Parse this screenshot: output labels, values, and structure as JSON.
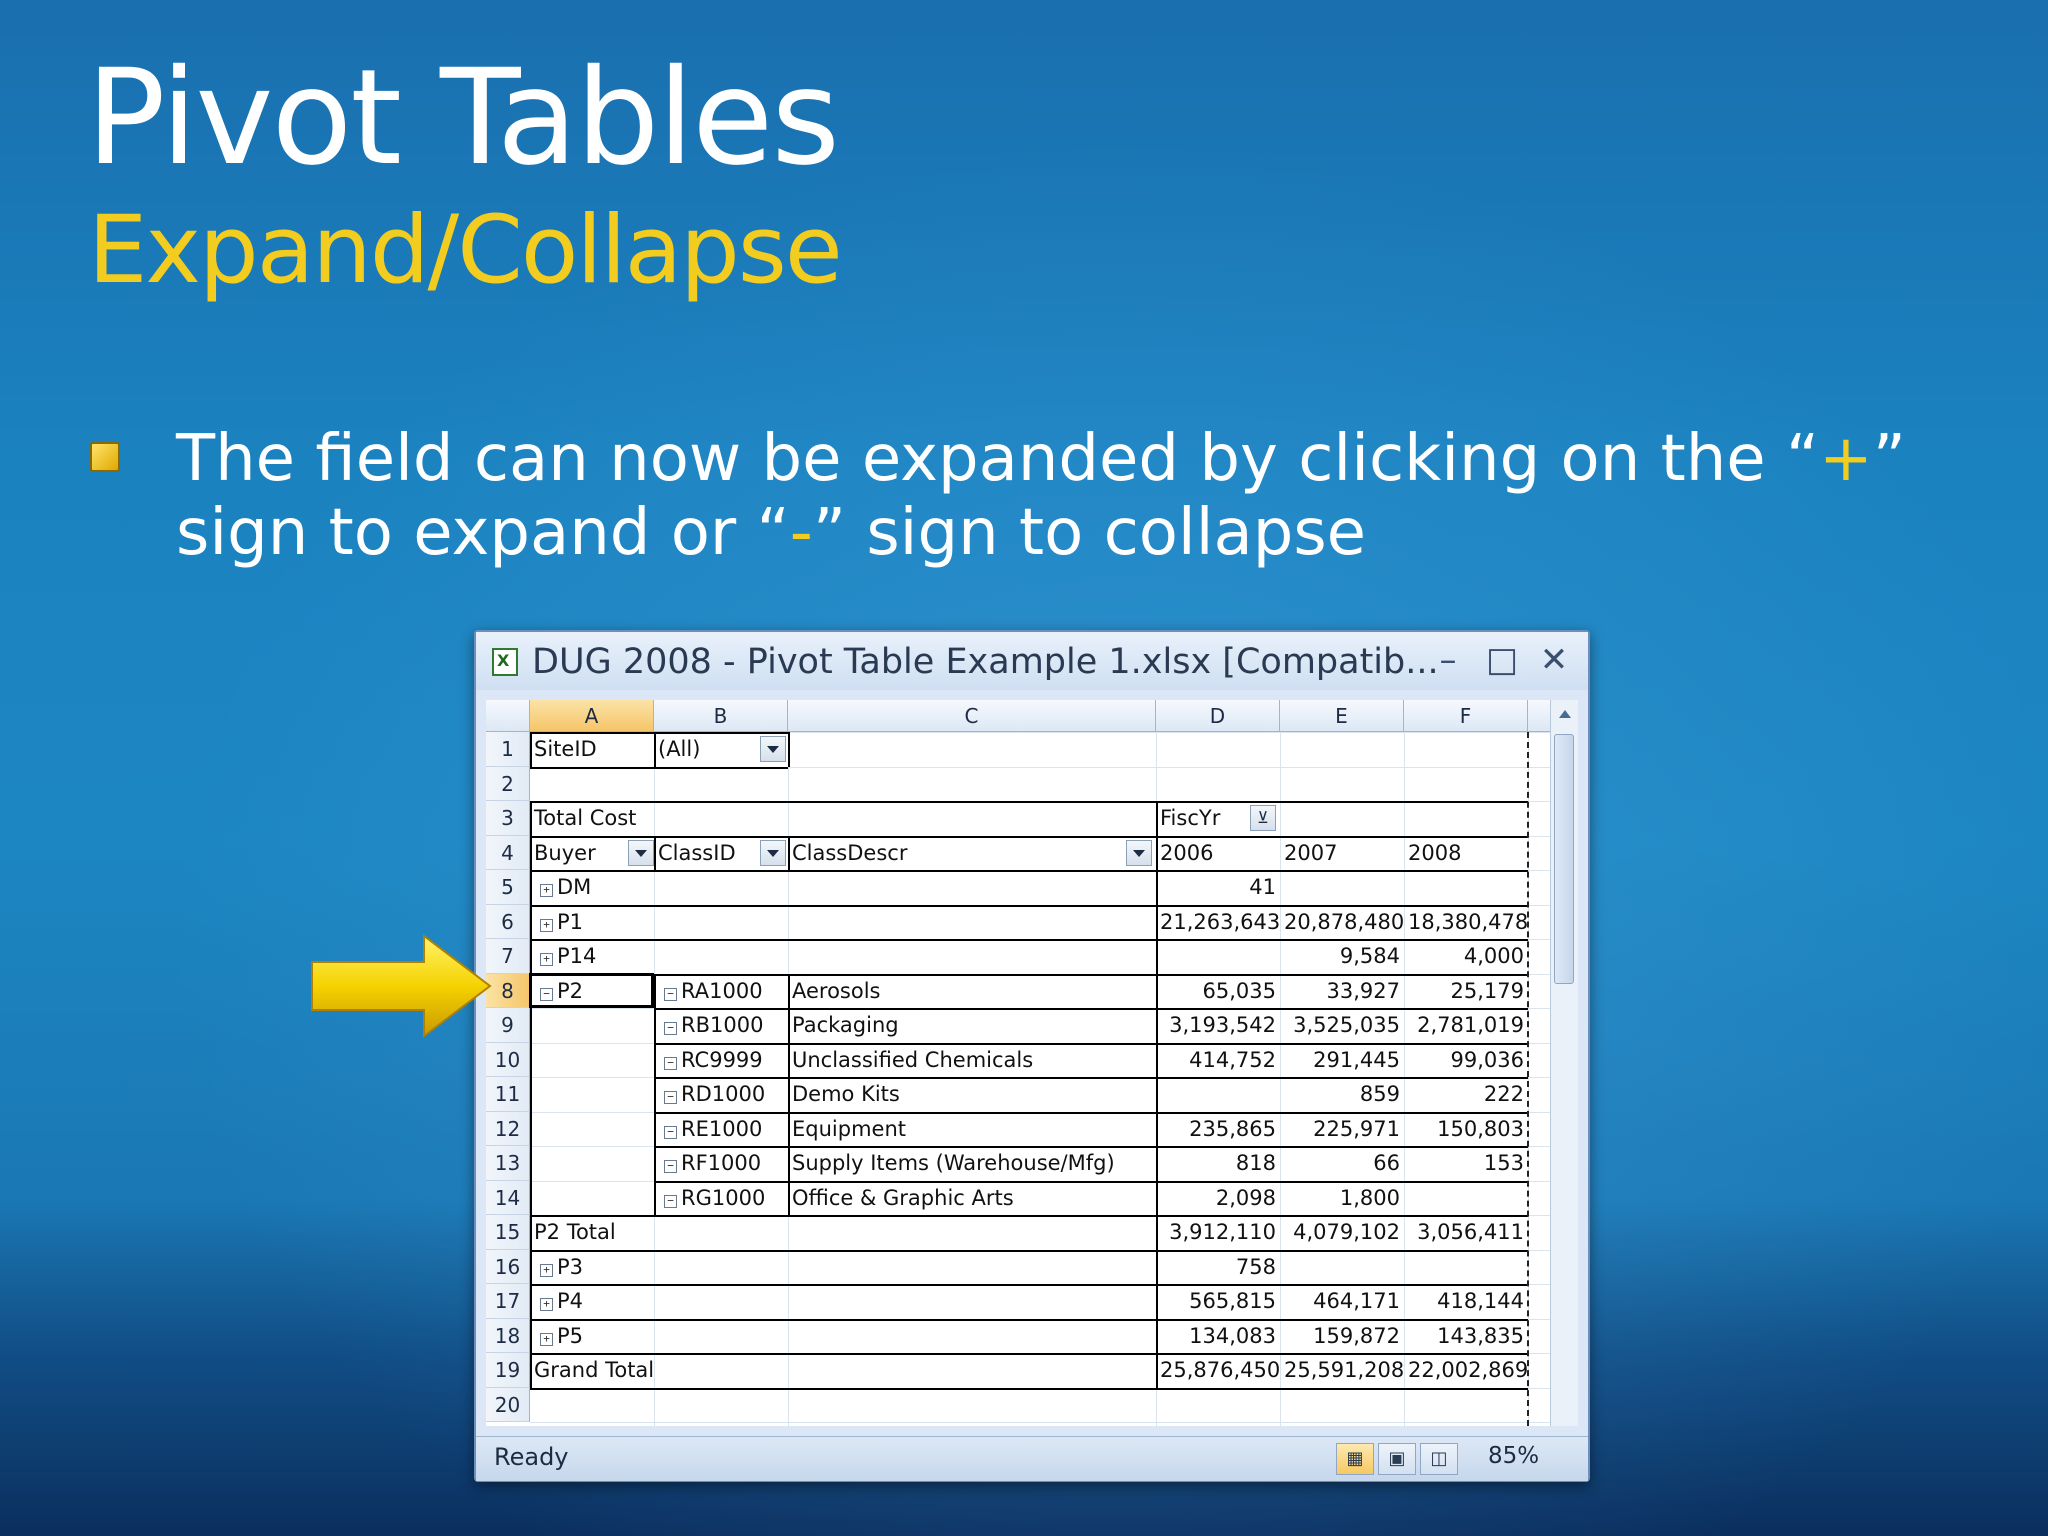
{
  "slide": {
    "title": "Pivot Tables",
    "subtitle": "Expand/Collapse",
    "bullet_before_plus": "The field can now be expanded by clicking on the “",
    "plus": "+",
    "bullet_mid": "” sign to expand or “",
    "minus": "-",
    "bullet_after_minus": "” sign to collapse"
  },
  "window": {
    "title": "DUG 2008 - Pivot Table Example 1.xlsx  [Compatib...",
    "minimize": "–",
    "maximize": "□",
    "close": "✕"
  },
  "columns": [
    "A",
    "B",
    "C",
    "D",
    "E",
    "F"
  ],
  "row_numbers": [
    "1",
    "2",
    "3",
    "4",
    "5",
    "6",
    "7",
    "8",
    "9",
    "10",
    "11",
    "12",
    "13",
    "14",
    "15",
    "16",
    "17",
    "18",
    "19",
    "20"
  ],
  "cells": {
    "r1": {
      "a": "SiteID",
      "b": "(All)"
    },
    "r3": {
      "a": "Total Cost",
      "d": "FiscYr"
    },
    "r4": {
      "a": "Buyer",
      "b": "ClassID",
      "c": "ClassDescr",
      "d": "2006",
      "e": "2007",
      "f": "2008"
    },
    "r5": {
      "a": "DM",
      "d": "41"
    },
    "r6": {
      "a": "P1",
      "d": "21,263,643",
      "e": "20,878,480",
      "f": "18,380,478"
    },
    "r7": {
      "a": "P14",
      "e": "9,584",
      "f": "4,000"
    },
    "r8": {
      "a": "P2",
      "b": "RA1000",
      "c": "Aerosols",
      "d": "65,035",
      "e": "33,927",
      "f": "25,179"
    },
    "r9": {
      "b": "RB1000",
      "c": "Packaging",
      "d": "3,193,542",
      "e": "3,525,035",
      "f": "2,781,019"
    },
    "r10": {
      "b": "RC9999",
      "c": "Unclassified Chemicals",
      "d": "414,752",
      "e": "291,445",
      "f": "99,036"
    },
    "r11": {
      "b": "RD1000",
      "c": "Demo Kits",
      "e": "859",
      "f": "222"
    },
    "r12": {
      "b": "RE1000",
      "c": "Equipment",
      "d": "235,865",
      "e": "225,971",
      "f": "150,803"
    },
    "r13": {
      "b": "RF1000",
      "c": "Supply Items (Warehouse/Mfg)",
      "d": "818",
      "e": "66",
      "f": "153"
    },
    "r14": {
      "b": "RG1000",
      "c": "Office & Graphic Arts",
      "d": "2,098",
      "e": "1,800"
    },
    "r15": {
      "a": "P2 Total",
      "d": "3,912,110",
      "e": "4,079,102",
      "f": "3,056,411"
    },
    "r16": {
      "a": "P3",
      "d": "758"
    },
    "r17": {
      "a": "P4",
      "d": "565,815",
      "e": "464,171",
      "f": "418,144"
    },
    "r18": {
      "a": "P5",
      "d": "134,083",
      "e": "159,872",
      "f": "143,835"
    },
    "r19": {
      "a": "Grand Total",
      "d": "25,876,450",
      "e": "25,591,208",
      "f": "22,002,869"
    }
  },
  "status": {
    "ready": "Ready",
    "zoom": "85%"
  },
  "colors": {
    "accent_yellow": "#f2cc1e",
    "selected_header": "#f5c56a"
  }
}
